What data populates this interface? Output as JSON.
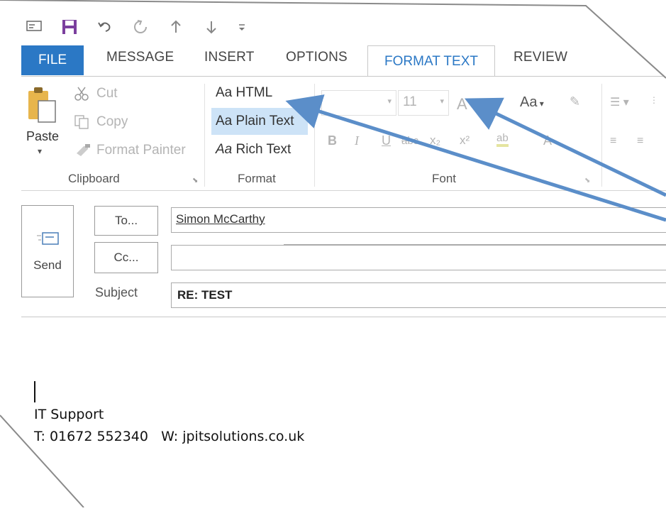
{
  "qat": {
    "icons": [
      "mail-icon",
      "save-icon",
      "undo-icon",
      "redo-icon",
      "up-arrow-icon",
      "down-arrow-icon",
      "customize-icon"
    ]
  },
  "tabs": {
    "file": "FILE",
    "message": "MESSAGE",
    "insert": "INSERT",
    "options": "OPTIONS",
    "format_text": "FORMAT TEXT",
    "review": "REVIEW",
    "active": "FORMAT TEXT"
  },
  "clipboard": {
    "paste": "Paste",
    "cut": "Cut",
    "copy": "Copy",
    "format_painter": "Format Painter",
    "group_label": "Clipboard"
  },
  "format": {
    "html": "HTML",
    "plain_text": "Plain Text",
    "rich_text": "Rich Text",
    "prefix": "Aa",
    "group_label": "Format",
    "selected": "Plain Text"
  },
  "font": {
    "size": "11",
    "change_case": "Aa",
    "group_label": "Font",
    "bold": "B",
    "italic": "I",
    "underline": "U",
    "strike": "abc",
    "subscript": "x₂",
    "superscript": "x²",
    "highlight": "ab",
    "font_color": "A",
    "grow": "A",
    "shrink": "A"
  },
  "compose": {
    "send_label": "Send",
    "to_button": "To...",
    "cc_button": "Cc...",
    "subject_label": "Subject",
    "to_value": "Simon McCarthy",
    "cc_value": "",
    "subject_value": "RE: TEST"
  },
  "signature": {
    "line1": "IT Support",
    "line2": "T: 01672 552340   W: jpitsolutions.co.uk"
  },
  "colors": {
    "accent": "#2b78c5",
    "file_tab": "#2b78c5",
    "selected_bg": "#cde3f7",
    "arrow": "#5b8ec9"
  }
}
